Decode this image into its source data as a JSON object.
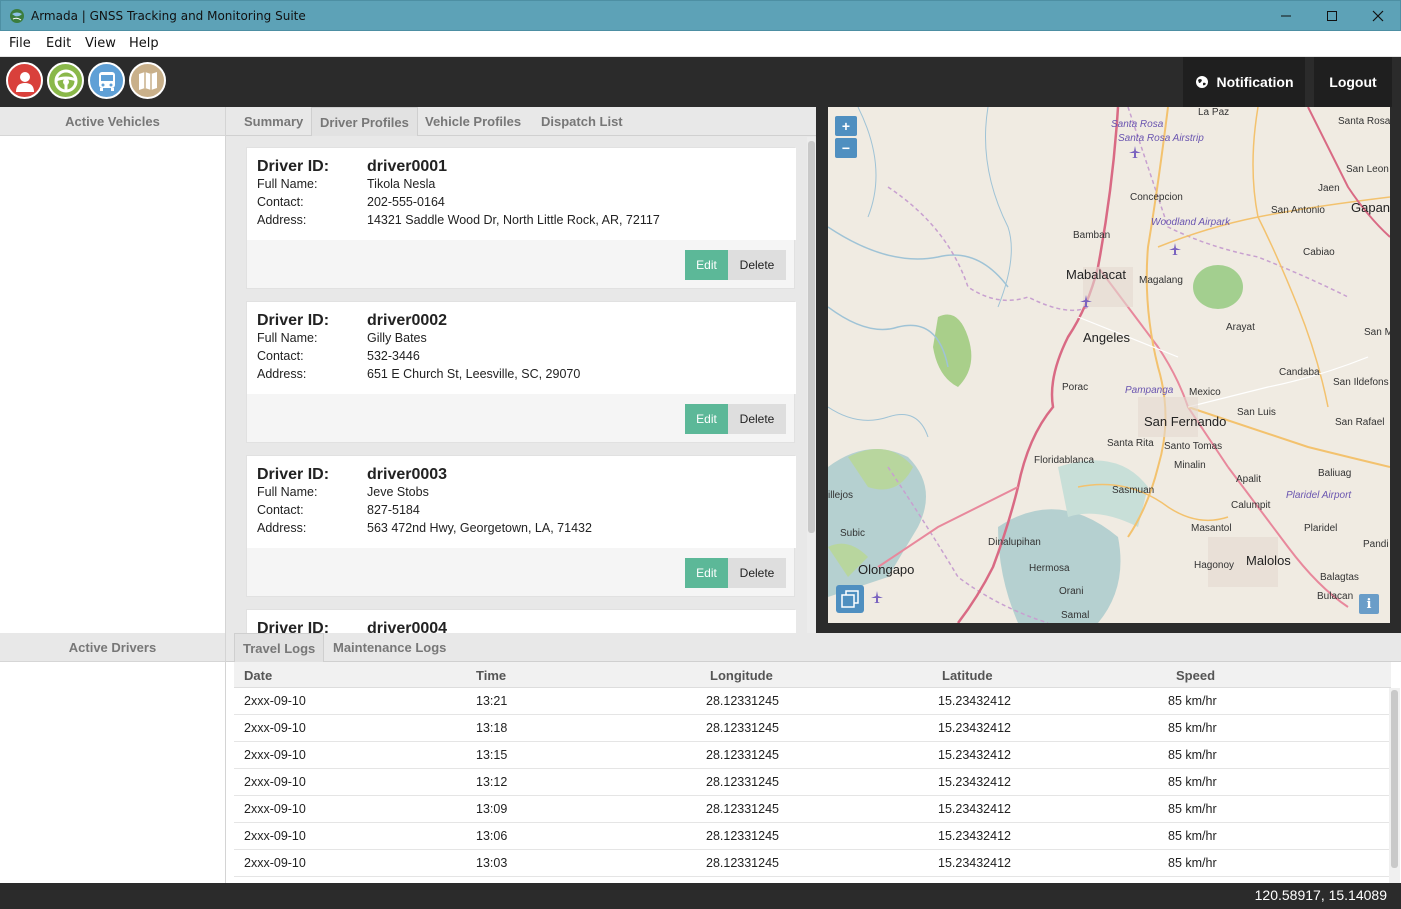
{
  "window": {
    "title": "Armada | GNSS Tracking and Monitoring Suite",
    "minimize": "─",
    "maximize": "☐",
    "close": "✕"
  },
  "menu": [
    "File",
    "Edit",
    "View",
    "Help"
  ],
  "toolbar": {
    "notification_label": "Notification",
    "logout_label": "Logout",
    "icons": [
      "user-icon",
      "steering-wheel-icon",
      "bus-icon",
      "map-icon"
    ]
  },
  "left": {
    "vehicles_header": "Active Vehicles",
    "drivers_header": "Active Drivers"
  },
  "tabs_top": [
    "Summary",
    "Driver Profiles",
    "Vehicle Profiles",
    "Dispatch List"
  ],
  "tabs_top_active": "Driver Profiles",
  "profile_labels": {
    "id": "Driver ID:",
    "name": "Full Name:",
    "contact": "Contact:",
    "address": "Address:",
    "edit": "Edit",
    "delete": "Delete"
  },
  "drivers": [
    {
      "id": "driver0001",
      "name": "Tikola Nesla",
      "contact": "202-555-0164",
      "address": "14321 Saddle Wood Dr, North Little Rock, AR, 72117"
    },
    {
      "id": "driver0002",
      "name": "Gilly Bates",
      "contact": "532-3446",
      "address": "651 E Church St, Leesville, SC, 29070"
    },
    {
      "id": "driver0003",
      "name": "Jeve Stobs",
      "contact": "827-5184",
      "address": "563 472nd Hwy, Georgetown, LA, 71432"
    },
    {
      "id": "driver0004",
      "name": "",
      "contact": "",
      "address": ""
    }
  ],
  "map": {
    "zoom_in": "+",
    "zoom_out": "−",
    "info": "i",
    "labels": [
      "La Paz",
      "Santa Rosa",
      "Santa Rosa Airstrip",
      "San Leon",
      "Jaen",
      "Gapan",
      "San Antonio",
      "Concepcion",
      "Woodland Airpark",
      "Bamban",
      "Cabiao",
      "Mabalacat",
      "Magalang",
      "Arayat",
      "Angeles",
      "San M",
      "Candaba",
      "Porac",
      "Pampanga",
      "Mexico",
      "San Ildefons",
      "San Fernando",
      "San Luis",
      "San Rafael",
      "Santa Rita",
      "Santo Tomas",
      "Floridablanca",
      "Minalin",
      "Baliuag",
      "Apalit",
      "Sasmuan",
      "Plaridel Airport",
      "illejos",
      "Calumpit",
      "Plaridel",
      "Masantol",
      "Subic",
      "Dinalupihan",
      "Pandi",
      "Olongapo",
      "Hermosa",
      "Hagonoy",
      "Malolos",
      "Balagtas",
      "Orani",
      "Bulacan",
      "Samal"
    ]
  },
  "tabs_bottom": [
    "Travel Logs",
    "Maintenance Logs"
  ],
  "tabs_bottom_active": "Travel Logs",
  "logs": {
    "headers": [
      "Date",
      "Time",
      "Longitude",
      "Latitude",
      "Speed"
    ],
    "rows": [
      [
        "2xxx-09-10",
        "13:21",
        "28.12331245",
        "15.23432412",
        "85 km/hr"
      ],
      [
        "2xxx-09-10",
        "13:18",
        "28.12331245",
        "15.23432412",
        "85 km/hr"
      ],
      [
        "2xxx-09-10",
        "13:15",
        "28.12331245",
        "15.23432412",
        "85 km/hr"
      ],
      [
        "2xxx-09-10",
        "13:12",
        "28.12331245",
        "15.23432412",
        "85 km/hr"
      ],
      [
        "2xxx-09-10",
        "13:09",
        "28.12331245",
        "15.23432412",
        "85 km/hr"
      ],
      [
        "2xxx-09-10",
        "13:06",
        "28.12331245",
        "15.23432412",
        "85 km/hr"
      ],
      [
        "2xxx-09-10",
        "13:03",
        "28.12331245",
        "15.23432412",
        "85 km/hr"
      ]
    ]
  },
  "status": {
    "coords": "120.58917, 15.14089"
  },
  "colors": {
    "titlebar": "#5da2b7",
    "dark": "#2b2b2b",
    "edit": "#5cb898",
    "user": "#d9403b",
    "wheel": "#8ab84a",
    "bus": "#5fa0d6",
    "map": "#c9b08a"
  }
}
